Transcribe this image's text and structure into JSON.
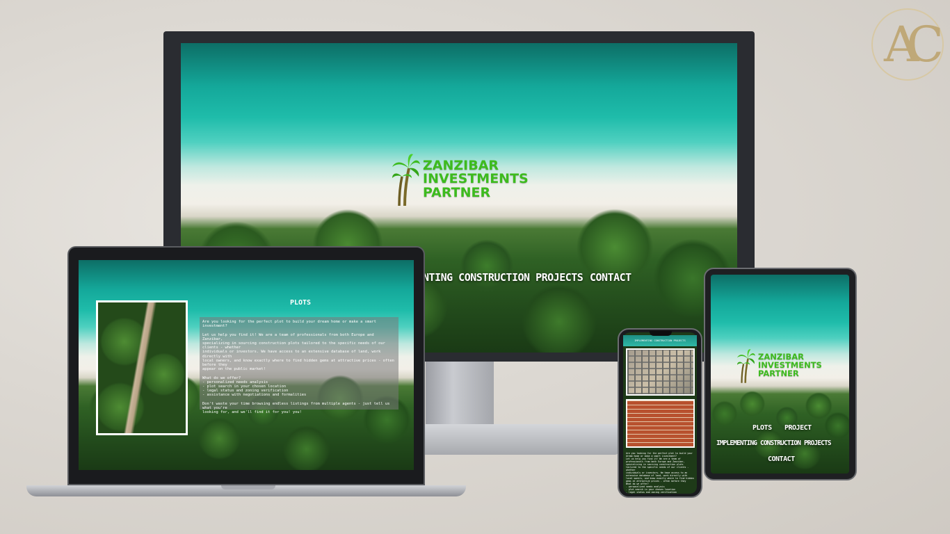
{
  "brand": {
    "logo_line1": "ZANZIBAR",
    "logo_line2": "INVESTMENTS",
    "logo_line3": "PARTNER",
    "mark_letters": "AC",
    "logo_color": "#3dbb1e"
  },
  "monitor": {
    "nav_item_1": "NTING CONSTRUCTION PROJECTS",
    "nav_item_2": "CONTACT"
  },
  "laptop": {
    "heading": "PLOTS",
    "panel_lines": [
      "Are you looking for the perfect plot to build your dream home or make a smart investment?",
      "",
      "Let us help you find it! We are a team of professionals from both Europe and Zanzibar,",
      "specializing in sourcing construction plots tailored to the specific needs of our clients - whether",
      "individuals or investors. We have access to an extensive database of land, work directly with",
      "local owners, and know exactly where to find hidden gems at attractive prices - often before they",
      "appear on the public market!",
      "",
      "What do we offer?",
      "- personalized needs analysis",
      "- plot search in your chosen location",
      "- legal status and zoning verification",
      "- assistance with negotiations and formalities",
      "",
      "Don't waste your time browsing endless listings from multiple agents - just tell us what you're",
      "looking for, and we'll find it for you! you!"
    ]
  },
  "phone": {
    "title": "IMPLEMENTING CONSTRUCTION PROJECTS"
  },
  "tablet": {
    "nav_plots": "PLOTS",
    "nav_project": "PROJECT",
    "nav_implementing": "IMPLEMENTING CONSTRUCTION PROJECTS",
    "nav_contact": "CONTACT"
  }
}
